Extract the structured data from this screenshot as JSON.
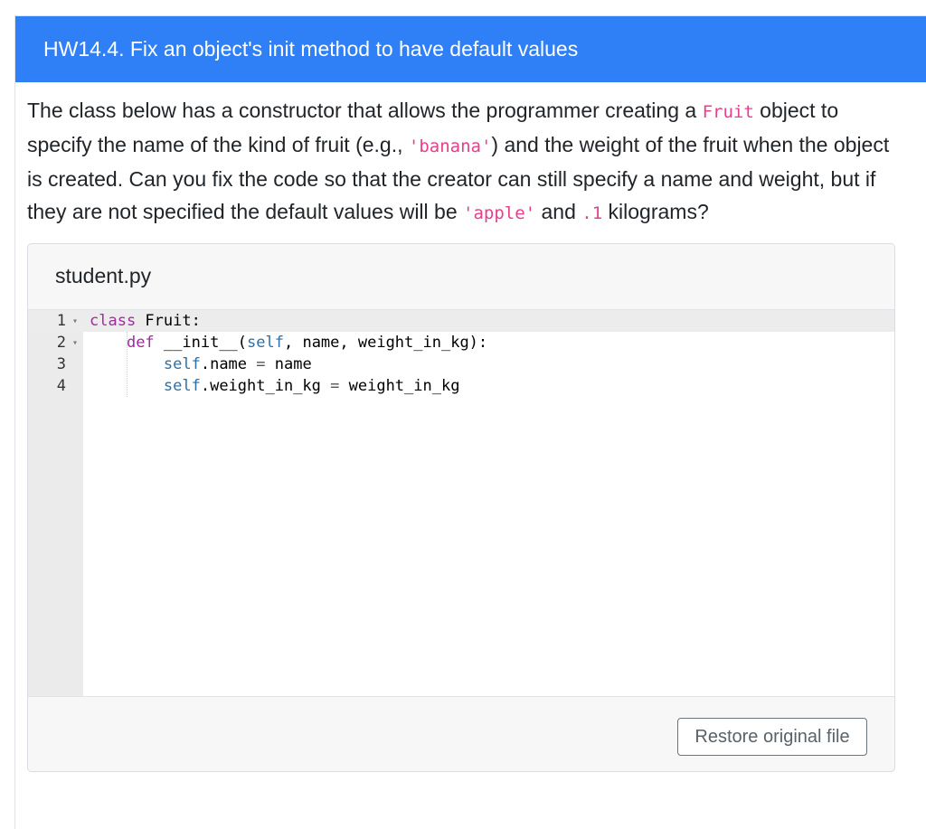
{
  "card": {
    "title": "HW14.4. Fix an object's init method to have default values"
  },
  "prompt": {
    "text_1": "The class below has a constructor that allows the programmer creating a ",
    "code_1": "Fruit",
    "text_2": " object to specify the name of the kind of fruit (e.g., ",
    "code_2": "'banana'",
    "text_3": ") and the weight of the fruit when the object is created. Can you fix the code so that the creator can still specify a name and weight, but if they are not specified the default values will be ",
    "code_3": "'apple'",
    "text_4": " and ",
    "code_4": ".1",
    "text_5": " kilograms?"
  },
  "file": {
    "name": "student.py",
    "line_numbers": [
      "1",
      "2",
      "3",
      "4"
    ],
    "fold_marker": "▾",
    "code": {
      "l1_kw": "class",
      "l1_rest": " Fruit:",
      "l2_indent": "    ",
      "l2_kw": "def",
      "l2_a": " __init__(",
      "l2_self": "self",
      "l2_b": ", name, weight_in_kg):",
      "l3_indent": "        ",
      "l3_self": "self",
      "l3_a": ".name ",
      "l3_eq": "=",
      "l3_b": " name",
      "l4_indent": "        ",
      "l4_self": "self",
      "l4_a": ".weight_in_kg ",
      "l4_eq": "=",
      "l4_b": " weight_in_kg"
    }
  },
  "actions": {
    "restore_label": "Restore original file"
  }
}
